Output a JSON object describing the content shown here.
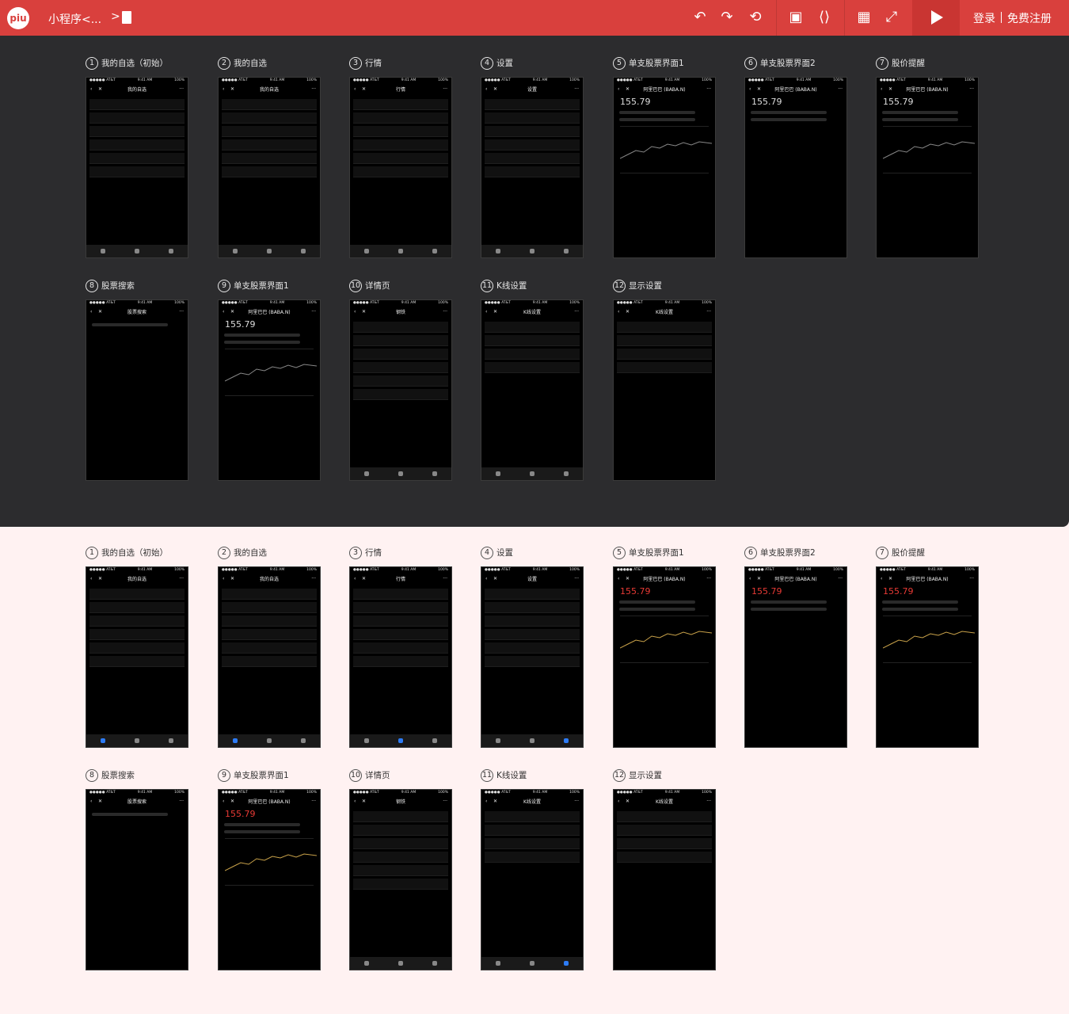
{
  "topbar": {
    "logo": "piu",
    "doc_title": "小程序<...",
    "doc_arrow": ">",
    "login": "登录",
    "register": "免费注册"
  },
  "screens_dark": [
    {
      "num": "1",
      "label": "我的自选（初始）"
    },
    {
      "num": "2",
      "label": "我的自选"
    },
    {
      "num": "3",
      "label": "行情"
    },
    {
      "num": "4",
      "label": "设置"
    },
    {
      "num": "5",
      "label": "单支股票界面1"
    },
    {
      "num": "6",
      "label": "单支股票界面2"
    },
    {
      "num": "7",
      "label": "股价提醒"
    },
    {
      "num": "8",
      "label": "股票搜索"
    },
    {
      "num": "9",
      "label": "单支股票界面1"
    },
    {
      "num": "10",
      "label": "详情页"
    },
    {
      "num": "11",
      "label": "K线设置"
    },
    {
      "num": "12",
      "label": "显示设置"
    }
  ],
  "screens_light": [
    {
      "num": "1",
      "label": "我的自选（初始）"
    },
    {
      "num": "2",
      "label": "我的自选"
    },
    {
      "num": "3",
      "label": "行情"
    },
    {
      "num": "4",
      "label": "设置"
    },
    {
      "num": "5",
      "label": "单支股票界面1"
    },
    {
      "num": "6",
      "label": "单支股票界面2"
    },
    {
      "num": "7",
      "label": "股价提醒"
    },
    {
      "num": "8",
      "label": "股票搜索"
    },
    {
      "num": "9",
      "label": "单支股票界面1"
    },
    {
      "num": "10",
      "label": "详情页"
    },
    {
      "num": "11",
      "label": "K线设置"
    },
    {
      "num": "12",
      "label": "显示设置"
    }
  ],
  "phone": {
    "carrier": "●●●●● AT&T",
    "time": "9:41 AM",
    "battery": "100%",
    "titles": [
      "我的自选",
      "我的自选",
      "行情",
      "设置",
      "阿里巴巴 (BABA.N)",
      "阿里巴巴 (BABA.N)",
      "阿里巴巴 (BABA.N)",
      "股票搜索",
      "阿里巴巴 (BABA.N)",
      "钢铁",
      "K线设置",
      "K线设置"
    ],
    "price": "155.79"
  }
}
